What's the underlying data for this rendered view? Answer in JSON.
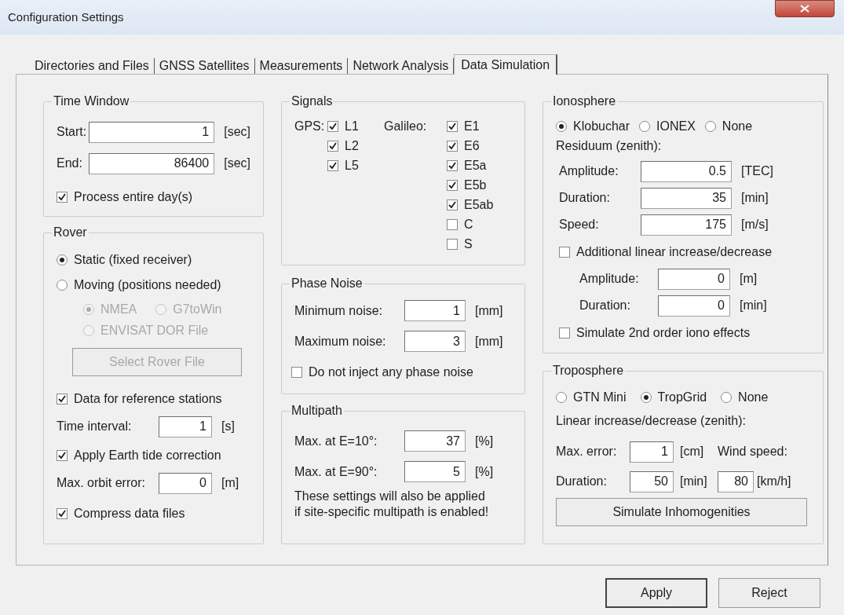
{
  "window": {
    "title": "Configuration Settings"
  },
  "tabs": [
    {
      "label": "Directories and Files",
      "selected": false
    },
    {
      "label": "GNSS Satellites",
      "selected": false
    },
    {
      "label": "Measurements",
      "selected": false
    },
    {
      "label": "Network Analysis",
      "selected": false
    },
    {
      "label": "Data Simulation",
      "selected": true
    }
  ],
  "time_window": {
    "title": "Time Window",
    "start": {
      "label": "Start:",
      "value": "1",
      "unit": "[sec]"
    },
    "end": {
      "label": "End:",
      "value": "86400",
      "unit": "[sec]"
    },
    "process_entire_day": {
      "label": "Process entire day(s)",
      "checked": true
    }
  },
  "rover": {
    "title": "Rover",
    "modes": [
      {
        "label": "Static (fixed receiver)",
        "selected": true
      },
      {
        "label": "Moving (positions needed)",
        "selected": false
      }
    ],
    "sources": [
      {
        "label": "NMEA",
        "selected": true,
        "disabled": true
      },
      {
        "label": "G7toWin",
        "selected": false,
        "disabled": true
      },
      {
        "label": "ENVISAT DOR File",
        "selected": false,
        "disabled": true
      }
    ],
    "select_button": {
      "label": "Select Rover File",
      "disabled": true
    },
    "reference_stations": {
      "label": "Data for reference stations",
      "checked": true
    },
    "time_interval": {
      "label": "Time interval:",
      "value": "1",
      "unit": "[s]"
    },
    "earth_tide": {
      "label": "Apply Earth tide correction",
      "checked": true
    },
    "max_orbit_error": {
      "label": "Max. orbit error:",
      "value": "0",
      "unit": "[m]"
    },
    "compress": {
      "label": "Compress data files",
      "checked": true
    }
  },
  "signals": {
    "title": "Signals",
    "gps_label": "GPS:",
    "gps": [
      {
        "label": "L1",
        "checked": true
      },
      {
        "label": "L2",
        "checked": true
      },
      {
        "label": "L5",
        "checked": true
      }
    ],
    "galileo_label": "Galileo:",
    "galileo": [
      {
        "label": "E1",
        "checked": true
      },
      {
        "label": "E6",
        "checked": true
      },
      {
        "label": "E5a",
        "checked": true
      },
      {
        "label": "E5b",
        "checked": true
      },
      {
        "label": "E5ab",
        "checked": true
      },
      {
        "label": "C",
        "checked": false
      },
      {
        "label": "S",
        "checked": false
      }
    ]
  },
  "phase_noise": {
    "title": "Phase Noise",
    "fields": [
      {
        "label": "Minimum noise:",
        "value": "1",
        "unit": "[mm]"
      },
      {
        "label": "Maximum noise:",
        "value": "3",
        "unit": "[mm]"
      }
    ],
    "no_noise": {
      "label": "Do not inject any phase noise",
      "checked": false
    }
  },
  "multipath": {
    "title": "Multipath",
    "fields": [
      {
        "label": "Max. at E=10°:",
        "value": "37",
        "unit": "[%]"
      },
      {
        "label": "Max. at E=90°:",
        "value": "5",
        "unit": "[%]"
      }
    ],
    "note": "These settings will also be applied\nif site-specific multipath is enabled!"
  },
  "ionosphere": {
    "title": "Ionosphere",
    "models": [
      {
        "label": "Klobuchar",
        "selected": true
      },
      {
        "label": "IONEX",
        "selected": false
      },
      {
        "label": "None",
        "selected": false
      }
    ],
    "residuum_label": "Residuum (zenith):",
    "fields": [
      {
        "label": "Amplitude:",
        "value": "0.5",
        "unit": "[TEC]"
      },
      {
        "label": "Duration:",
        "value": "35",
        "unit": "[min]"
      },
      {
        "label": "Speed:",
        "value": "175",
        "unit": "[m/s]"
      }
    ],
    "linear": {
      "label": "Additional linear increase/decrease",
      "checked": false
    },
    "linear_fields": [
      {
        "label": "Amplitude:",
        "value": "0",
        "unit": "[m]"
      },
      {
        "label": "Duration:",
        "value": "0",
        "unit": "[min]"
      }
    ],
    "second_order": {
      "label": "Simulate 2nd order iono effects",
      "checked": false
    }
  },
  "troposphere": {
    "title": "Troposphere",
    "models": [
      {
        "label": "GTN Mini",
        "selected": false
      },
      {
        "label": "TropGrid",
        "selected": true
      },
      {
        "label": "None",
        "selected": false
      }
    ],
    "linear_label": "Linear increase/decrease (zenith):",
    "max_error": {
      "label": "Max. error:",
      "value": "1",
      "unit": "[cm]"
    },
    "wind_label": "Wind speed:",
    "duration": {
      "label": "Duration:",
      "value": "50",
      "unit": "[min]"
    },
    "wind": {
      "value": "80",
      "unit": "[km/h]"
    },
    "button": "Simulate Inhomogenities"
  },
  "buttons": [
    {
      "label": "Apply",
      "default": true
    },
    {
      "label": "Reject",
      "default": false
    }
  ]
}
